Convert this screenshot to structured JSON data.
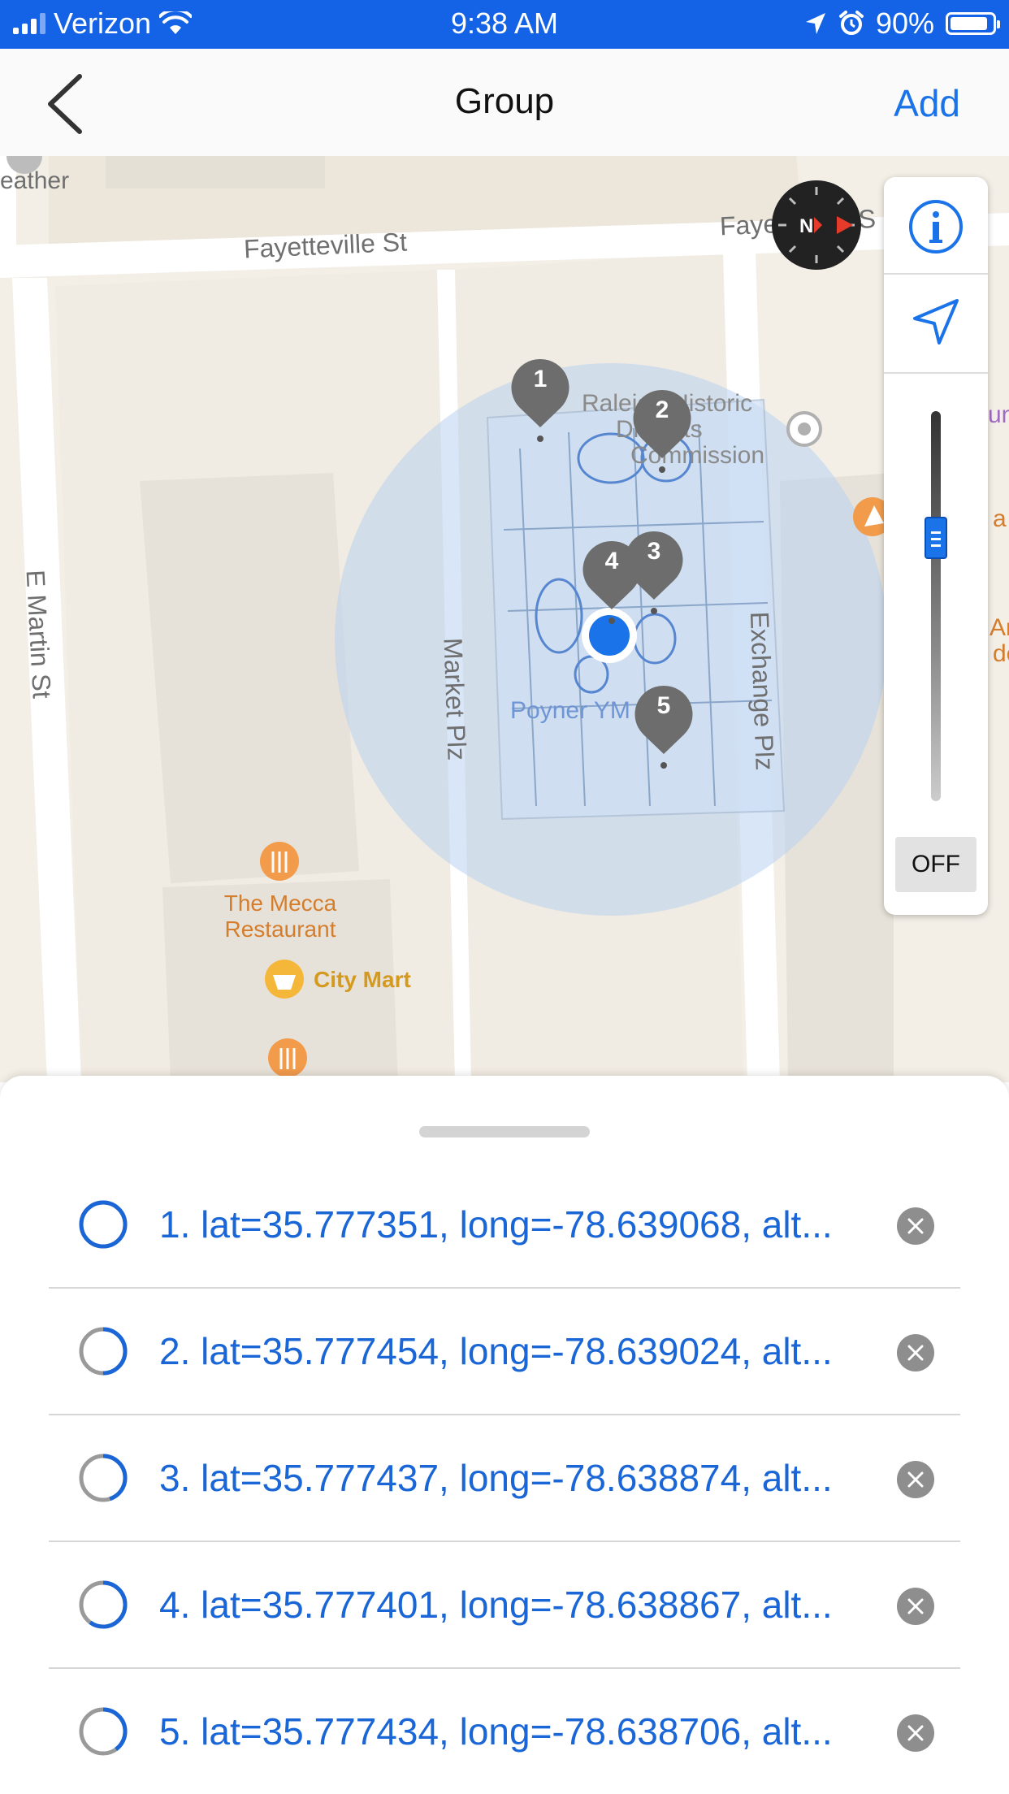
{
  "status_bar": {
    "carrier": "Verizon",
    "time": "9:38 AM",
    "battery": "90%",
    "battery_level": 0.9
  },
  "nav": {
    "title": "Group",
    "add_label": "Add"
  },
  "map": {
    "streets": {
      "fayetteville_top": "Fayetteville St",
      "fayetteville_right": "Fayette",
      "fayetteville_right_tail": "e S",
      "e_martin": "E Martin St",
      "market": "Market Plz",
      "exchange": "Exchange Plz",
      "weather": "eather"
    },
    "labels": {
      "raleigh": "Raleigh Historic",
      "districts": "Districts",
      "commission": "Commission",
      "poyner": "Poyner YM",
      "edge_un": "un",
      "edge_as": "a S",
      "edge_an": "An",
      "edge_de": "de"
    },
    "pois": {
      "mecca_line1": "The Mecca",
      "mecca_line2": "Restaurant",
      "city_mart": "City Mart"
    },
    "markers": [
      "1",
      "2",
      "3",
      "4",
      "5"
    ],
    "controls": {
      "info_icon": "info-icon",
      "location_icon": "location-arrow-icon",
      "off_label": "OFF"
    }
  },
  "points": [
    {
      "label": "1. lat=35.777351, long=-78.639068, alt...",
      "progress": 1.0
    },
    {
      "label": "2. lat=35.777454, long=-78.639024, alt...",
      "progress": 0.5
    },
    {
      "label": "3. lat=35.777437, long=-78.638874, alt...",
      "progress": 0.45
    },
    {
      "label": "4. lat=35.777401, long=-78.638867, alt...",
      "progress": 0.6
    },
    {
      "label": "5. lat=35.777434, long=-78.638706, alt...",
      "progress": 0.4
    }
  ],
  "colors": {
    "accent": "#1a73e8",
    "status_bar": "#1463e6",
    "marker": "#6d6d6d",
    "poi": "#f29b4b"
  }
}
